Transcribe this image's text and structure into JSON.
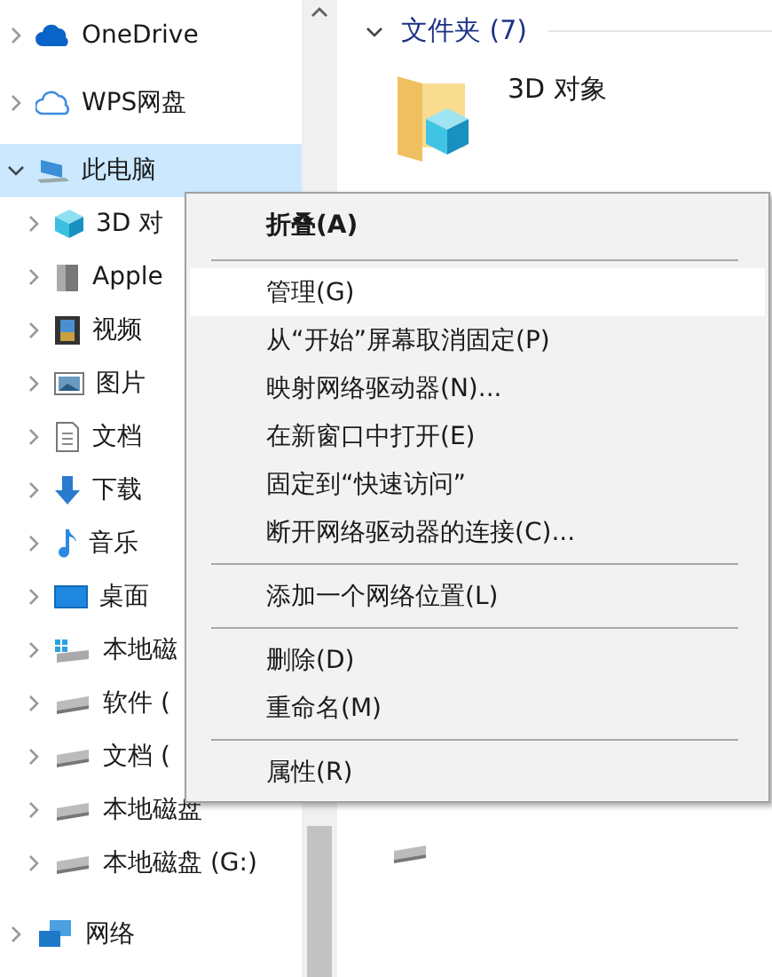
{
  "navigation_tree": [
    {
      "label": "OneDrive",
      "kind": "cloud",
      "selected": false,
      "expanded": false
    },
    {
      "label": "WPS网盘",
      "kind": "cloud-outline",
      "selected": false,
      "expanded": false
    },
    {
      "label": "此电脑",
      "kind": "computer",
      "selected": true,
      "expanded": true,
      "children": [
        {
          "label": "3D 对",
          "kind": "cube",
          "selected": false,
          "expanded": false
        },
        {
          "label": "Apple",
          "kind": "device",
          "selected": false,
          "expanded": false
        },
        {
          "label": "视频",
          "kind": "film",
          "selected": false,
          "expanded": false
        },
        {
          "label": "图片",
          "kind": "picture",
          "selected": false,
          "expanded": false
        },
        {
          "label": "文档",
          "kind": "document",
          "selected": false,
          "expanded": false
        },
        {
          "label": "下载",
          "kind": "download",
          "selected": false,
          "expanded": false
        },
        {
          "label": "音乐",
          "kind": "music",
          "selected": false,
          "expanded": false
        },
        {
          "label": "桌面",
          "kind": "desktop",
          "selected": false,
          "expanded": false
        },
        {
          "label": "本地磁",
          "kind": "system-drive",
          "selected": false,
          "expanded": false
        },
        {
          "label": "软件 (",
          "kind": "drive",
          "selected": false,
          "expanded": false
        },
        {
          "label": "文档 (",
          "kind": "drive",
          "selected": false,
          "expanded": false
        },
        {
          "label": "本地磁盘",
          "kind": "drive",
          "selected": false,
          "expanded": false
        },
        {
          "label": "本地磁盘 (G:)",
          "kind": "drive",
          "selected": false,
          "expanded": false
        }
      ]
    },
    {
      "label": "网络",
      "kind": "network",
      "selected": false,
      "expanded": false
    }
  ],
  "content": {
    "group": {
      "label": "文件夹 (7)",
      "expanded": true
    },
    "items": [
      {
        "label": "3D 对象",
        "kind": "cube-folder"
      }
    ]
  },
  "context_menu": {
    "items": [
      {
        "kind": "item",
        "label": "折叠(A)",
        "default": true,
        "selected": false
      },
      {
        "kind": "separator"
      },
      {
        "kind": "item",
        "label": "管理(G)",
        "default": false,
        "selected": true
      },
      {
        "kind": "item",
        "label": "从“开始”屏幕取消固定(P)",
        "default": false,
        "selected": false
      },
      {
        "kind": "item",
        "label": "映射网络驱动器(N)...",
        "default": false,
        "selected": false
      },
      {
        "kind": "item",
        "label": "在新窗口中打开(E)",
        "default": false,
        "selected": false
      },
      {
        "kind": "item",
        "label": "固定到“快速访问”",
        "default": false,
        "selected": false
      },
      {
        "kind": "item",
        "label": "断开网络驱动器的连接(C)...",
        "default": false,
        "selected": false
      },
      {
        "kind": "separator"
      },
      {
        "kind": "item",
        "label": "添加一个网络位置(L)",
        "default": false,
        "selected": false
      },
      {
        "kind": "separator"
      },
      {
        "kind": "item",
        "label": "删除(D)",
        "default": false,
        "selected": false
      },
      {
        "kind": "item",
        "label": "重命名(M)",
        "default": false,
        "selected": false
      },
      {
        "kind": "separator"
      },
      {
        "kind": "item",
        "label": "属性(R)",
        "default": false,
        "selected": false
      }
    ]
  }
}
